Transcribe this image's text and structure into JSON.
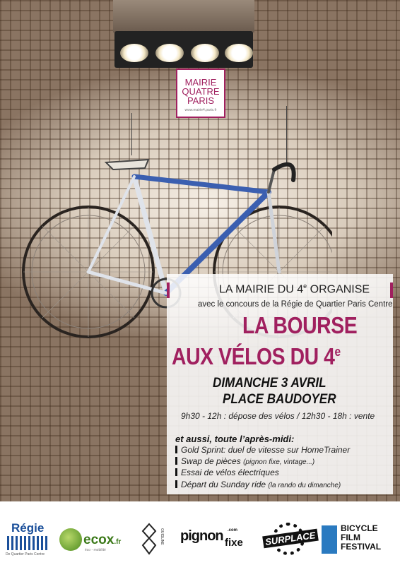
{
  "logo": {
    "line1": "MAIRIE",
    "line2": "QUATRE",
    "line3": "PARIS",
    "url": "www.mairie4.paris.fr"
  },
  "panel": {
    "organizer_prefix": "LA MAIRIE DU 4",
    "organizer_sup": "e",
    "organizer_suffix": " ORGANISE",
    "contest": "avec le concours de la Régie de Quartier Paris Centre",
    "title_line1": "LA BOURSE",
    "title_line2": "AUX VÉLOS DU 4",
    "title_sup": "e",
    "date": "DIMANCHE 3 AVRIL",
    "place": "PLACE BAUDOYER",
    "hours": "9h30 - 12h : dépose des vélos / 12h30 - 18h : vente",
    "also": "et aussi, toute l’après-midi:",
    "bullets": [
      {
        "main": "Gold Sprint: duel de vitesse sur HomeTrainer",
        "small": ""
      },
      {
        "main": "Swap de pièces ",
        "small": "(pignon fixe, vintage...)"
      },
      {
        "main": "Essai de vélos électriques",
        "small": ""
      },
      {
        "main": "Départ du Sunday ride ",
        "small": "(la rando du dimanche)"
      }
    ]
  },
  "sponsors": {
    "regie": "Régie",
    "regie_sub": "De Quartier Paris Centre",
    "ecox": "ecox",
    "ecox_tld": ".fr",
    "ecox_sub": "éco - mobilité",
    "guidline": "GUIDLINE",
    "pignon": "pignon",
    "pignon_fixe": "fixe",
    "pignon_com": ".com",
    "surplace": "SURPLACE",
    "bff1": "BICYCLE",
    "bff2": "FILM",
    "bff3": "FESTIVAL"
  },
  "colors": {
    "accent": "#a0205f",
    "frame_blue": "#3b5fb0"
  }
}
